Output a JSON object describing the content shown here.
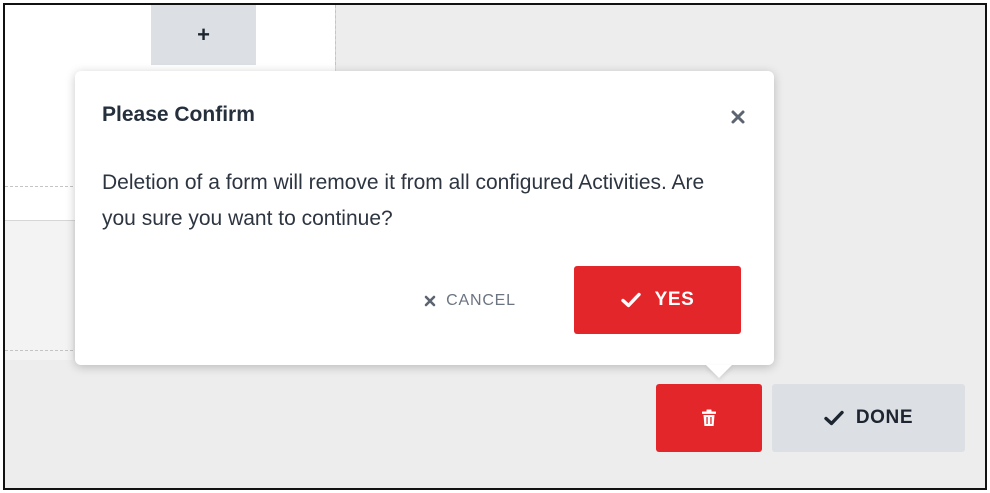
{
  "dialog": {
    "title": "Please Confirm",
    "message": "Deletion of a form will remove it from all configured Activities. Are you sure you want to continue?",
    "cancel_label": "CANCEL",
    "yes_label": "YES",
    "close_icon": "close-icon"
  },
  "toolbar": {
    "add_label": "+",
    "done_label": "DONE",
    "delete_icon": "trash-icon"
  },
  "colors": {
    "danger": "#e3262a",
    "neutral_button": "#dcdfe3",
    "text_dark": "#26303c",
    "background": "#ededed"
  }
}
